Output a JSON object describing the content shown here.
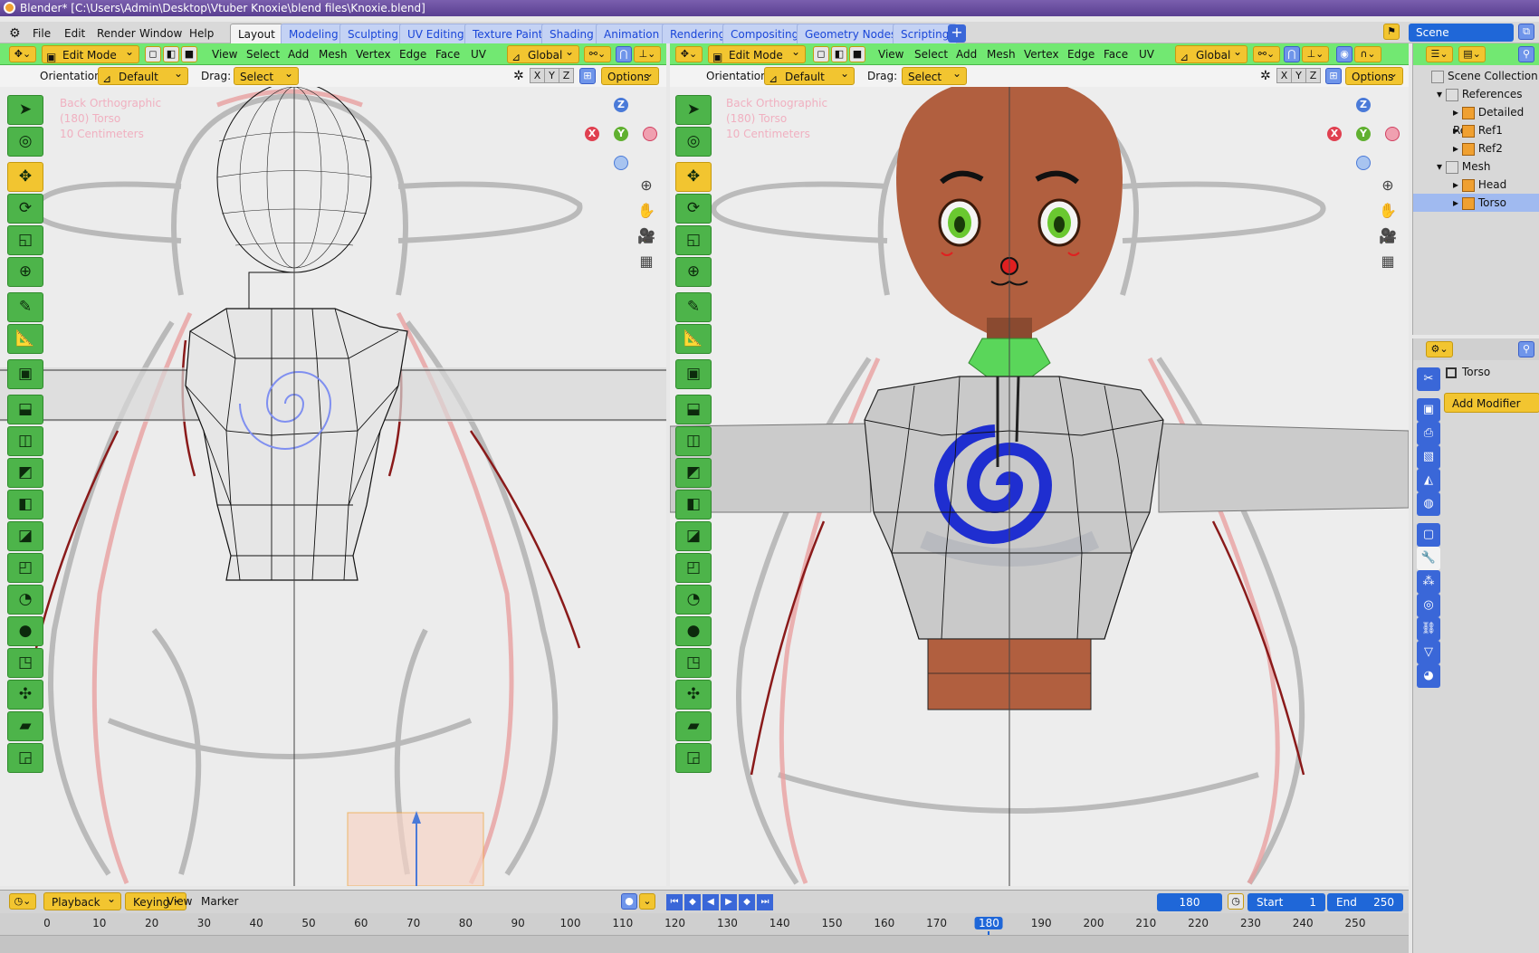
{
  "window": {
    "title": "Blender* [C:\\Users\\Admin\\Desktop\\Vtuber Knoxie\\blend files\\Knoxie.blend]"
  },
  "menu": [
    "File",
    "Edit",
    "Render",
    "Window",
    "Help"
  ],
  "workspace_tabs": [
    "Layout",
    "Modeling",
    "Sculpting",
    "UV Editing",
    "Texture Paint",
    "Shading",
    "Animation",
    "Rendering",
    "Compositing",
    "Geometry Nodes",
    "Scripting"
  ],
  "active_tab": "Layout",
  "scene_name": "Scene",
  "viewport_header": {
    "mode": "Edit Mode",
    "menus": [
      "View",
      "Select",
      "Add",
      "Mesh",
      "Vertex",
      "Edge",
      "Face",
      "UV"
    ],
    "transform_orientation": "Global"
  },
  "tool_settings": {
    "orientation_label": "Orientation:",
    "orientation_value": "Default",
    "drag_label": "Drag:",
    "drag_value": "Select Box",
    "axes": [
      "X",
      "Y",
      "Z"
    ],
    "options_label": "Options"
  },
  "viewport_overlay": {
    "view_name": "Back Orthographic",
    "object_info": "(180) Torso",
    "scale": "10 Centimeters"
  },
  "gizmo": {
    "z": "Z",
    "x": "X",
    "y": "Y"
  },
  "icons": {
    "tools": [
      "cursor-select-icon",
      "cursor-icon",
      "move-icon",
      "rotate-icon",
      "scale-icon",
      "transform-icon",
      "annotate-icon",
      "measure-icon",
      "add-cube-icon",
      "extrude-icon",
      "inset-icon",
      "bevel-icon",
      "loop-cut-icon",
      "knife-icon",
      "poly-build-icon",
      "spin-icon",
      "smooth-icon",
      "edge-slide-icon",
      "shrink-fatten-icon",
      "shear-icon",
      "rip-icon"
    ],
    "tool_glyphs": [
      "➤",
      "◎",
      "✥",
      "⟳",
      "◱",
      "⊕",
      "✎",
      "📐",
      "▣",
      "⬓",
      "◫",
      "◩",
      "◧",
      "◪",
      "◰",
      "◔",
      "●",
      "◳",
      "✣",
      "▰",
      "◲"
    ]
  },
  "outliner": {
    "root": "Scene Collection",
    "items": [
      {
        "label": "References",
        "depth": 1
      },
      {
        "label": "Detailed Re",
        "depth": 2
      },
      {
        "label": "Ref1",
        "depth": 2
      },
      {
        "label": "Ref2",
        "depth": 2
      },
      {
        "label": "Mesh",
        "depth": 1
      },
      {
        "label": "Head",
        "depth": 2
      },
      {
        "label": "Torso",
        "depth": 2
      }
    ],
    "selected": "Torso"
  },
  "properties": {
    "object_name": "Torso",
    "add_modifier_label": "Add Modifier"
  },
  "timeline": {
    "playback_label": "Playback",
    "keying_label": "Keying",
    "view_label": "View",
    "marker_label": "Marker",
    "current_frame": 180,
    "start_label": "Start",
    "start": 1,
    "end_label": "End",
    "end": 250,
    "ticks": [
      0,
      10,
      20,
      30,
      40,
      50,
      60,
      70,
      80,
      90,
      100,
      110,
      120,
      130,
      140,
      150,
      160,
      170,
      180,
      190,
      200,
      210,
      220,
      230,
      240,
      250
    ]
  },
  "colors": {
    "header_green": "#72e872",
    "tool_yellow": "#f2c530",
    "accent_blue": "#1f67d8",
    "skin": "#b15f3f",
    "shirt": "#c9c9c9",
    "spiral": "#1f2ed0"
  }
}
